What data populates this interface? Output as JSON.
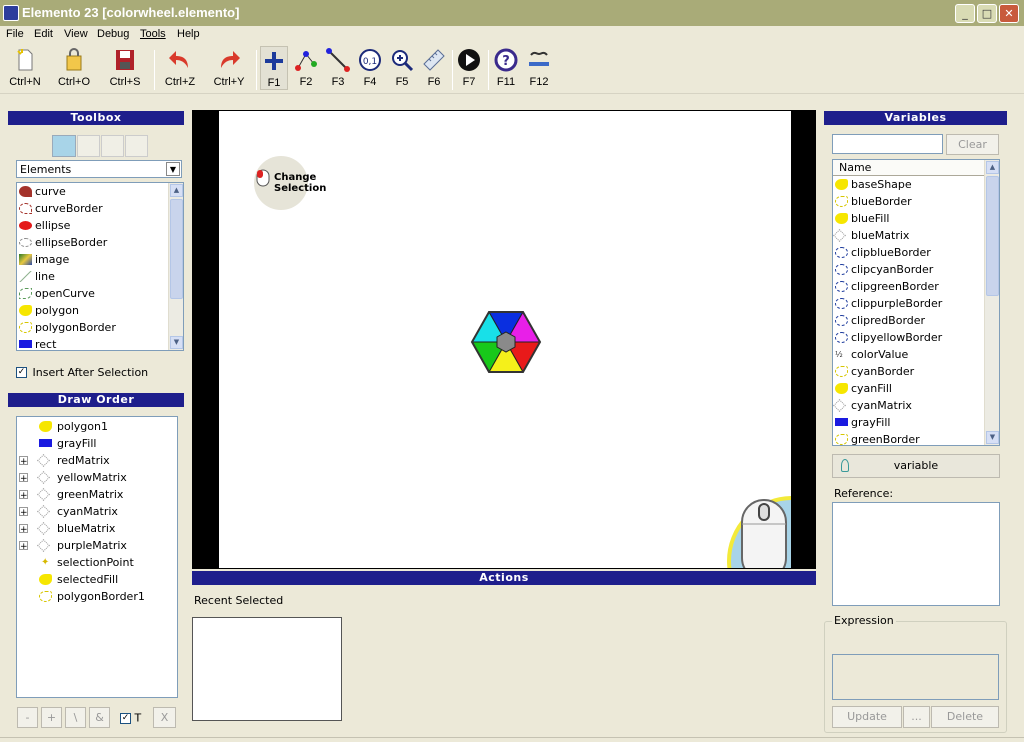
{
  "window": {
    "title": "Elemento 23 [colorwheel.elemento]",
    "min": "_",
    "max": "□",
    "close": "✕"
  },
  "menu": [
    "File",
    "Edit",
    "View",
    "Debug",
    "Tools",
    "Help"
  ],
  "toolbar": [
    {
      "label": "Ctrl+N",
      "icon": "new-file-icon"
    },
    {
      "label": "Ctrl+O",
      "icon": "open-icon"
    },
    {
      "label": "Ctrl+S",
      "icon": "save-icon"
    },
    {
      "label": "Ctrl+Z",
      "icon": "undo-icon"
    },
    {
      "label": "Ctrl+Y",
      "icon": "redo-icon"
    },
    {
      "label": "F1",
      "icon": "add-icon"
    },
    {
      "label": "F2",
      "icon": "points-icon"
    },
    {
      "label": "F3",
      "icon": "line-tool-icon"
    },
    {
      "label": "F4",
      "icon": "coords-icon"
    },
    {
      "label": "F5",
      "icon": "zoom-icon"
    },
    {
      "label": "F6",
      "icon": "ruler-icon"
    },
    {
      "label": "F7",
      "icon": "play-icon"
    },
    {
      "label": "F11",
      "icon": "help-icon"
    },
    {
      "label": "F12",
      "icon": "logo-icon"
    }
  ],
  "toolbox": {
    "header": "Toolbox",
    "dropdown": "Elements",
    "items": [
      "curve",
      "curveBorder",
      "ellipse",
      "ellipseBorder",
      "image",
      "line",
      "openCurve",
      "polygon",
      "polygonBorder",
      "rect"
    ],
    "insert_after": "Insert After Selection"
  },
  "draw_order": {
    "header": "Draw Order",
    "items": [
      "polygon1",
      "grayFill",
      "redMatrix",
      "yellowMatrix",
      "greenMatrix",
      "cyanMatrix",
      "blueMatrix",
      "purpleMatrix",
      "selectionPoint",
      "selectedFill",
      "polygonBorder1"
    ],
    "buttons": [
      "-",
      "+",
      "\\",
      "&",
      "T",
      "X"
    ]
  },
  "canvas": {
    "hint": "Change Selection"
  },
  "actions": {
    "header": "Actions",
    "recent": "Recent Selected"
  },
  "variables": {
    "header": "Variables",
    "clear": "Clear",
    "col": "Name",
    "items": [
      "baseShape",
      "blueBorder",
      "blueFill",
      "blueMatrix",
      "clipblueBorder",
      "clipcyanBorder",
      "clipgreenBorder",
      "clippurpleBorder",
      "clipredBorder",
      "clipyellowBorder",
      "colorValue",
      "cyanBorder",
      "cyanFill",
      "cyanMatrix",
      "grayFill",
      "greenBorder"
    ],
    "variable_btn": "variable",
    "reference": "Reference:",
    "expression": "Expression",
    "update": "Update",
    "dots": "...",
    "delete": "Delete"
  }
}
